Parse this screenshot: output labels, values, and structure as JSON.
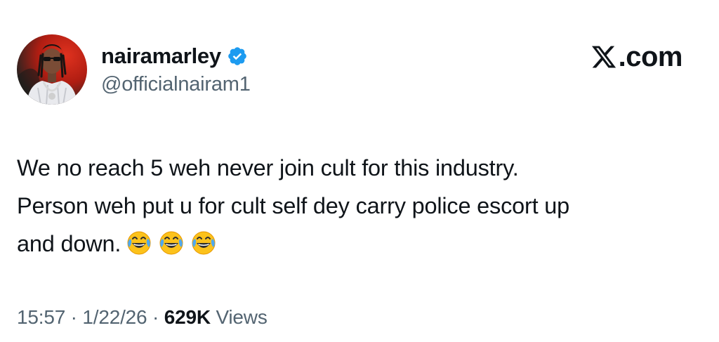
{
  "user": {
    "display_name": "nairamarley",
    "handle": "@officialnairam1",
    "verified": true,
    "avatar_icon": "profile-photo"
  },
  "brand": {
    "logo_text": ".com",
    "logo_icon": "x-logo-icon"
  },
  "tweet": {
    "lines": [
      "We no reach 5 weh never join cult for this industry.",
      "Person weh put u for cult self dey carry police escort up",
      "and down."
    ],
    "emojis": [
      "face-with-tears-of-joy",
      "face-with-tears-of-joy",
      "face-with-tears-of-joy"
    ]
  },
  "meta": {
    "time": "15:57",
    "separator": " · ",
    "date": "1/22/26",
    "views_count": "629K",
    "views_label": "Views"
  },
  "colors": {
    "text": "#0f1419",
    "muted": "#536471",
    "verified": "#1d9bf0"
  }
}
